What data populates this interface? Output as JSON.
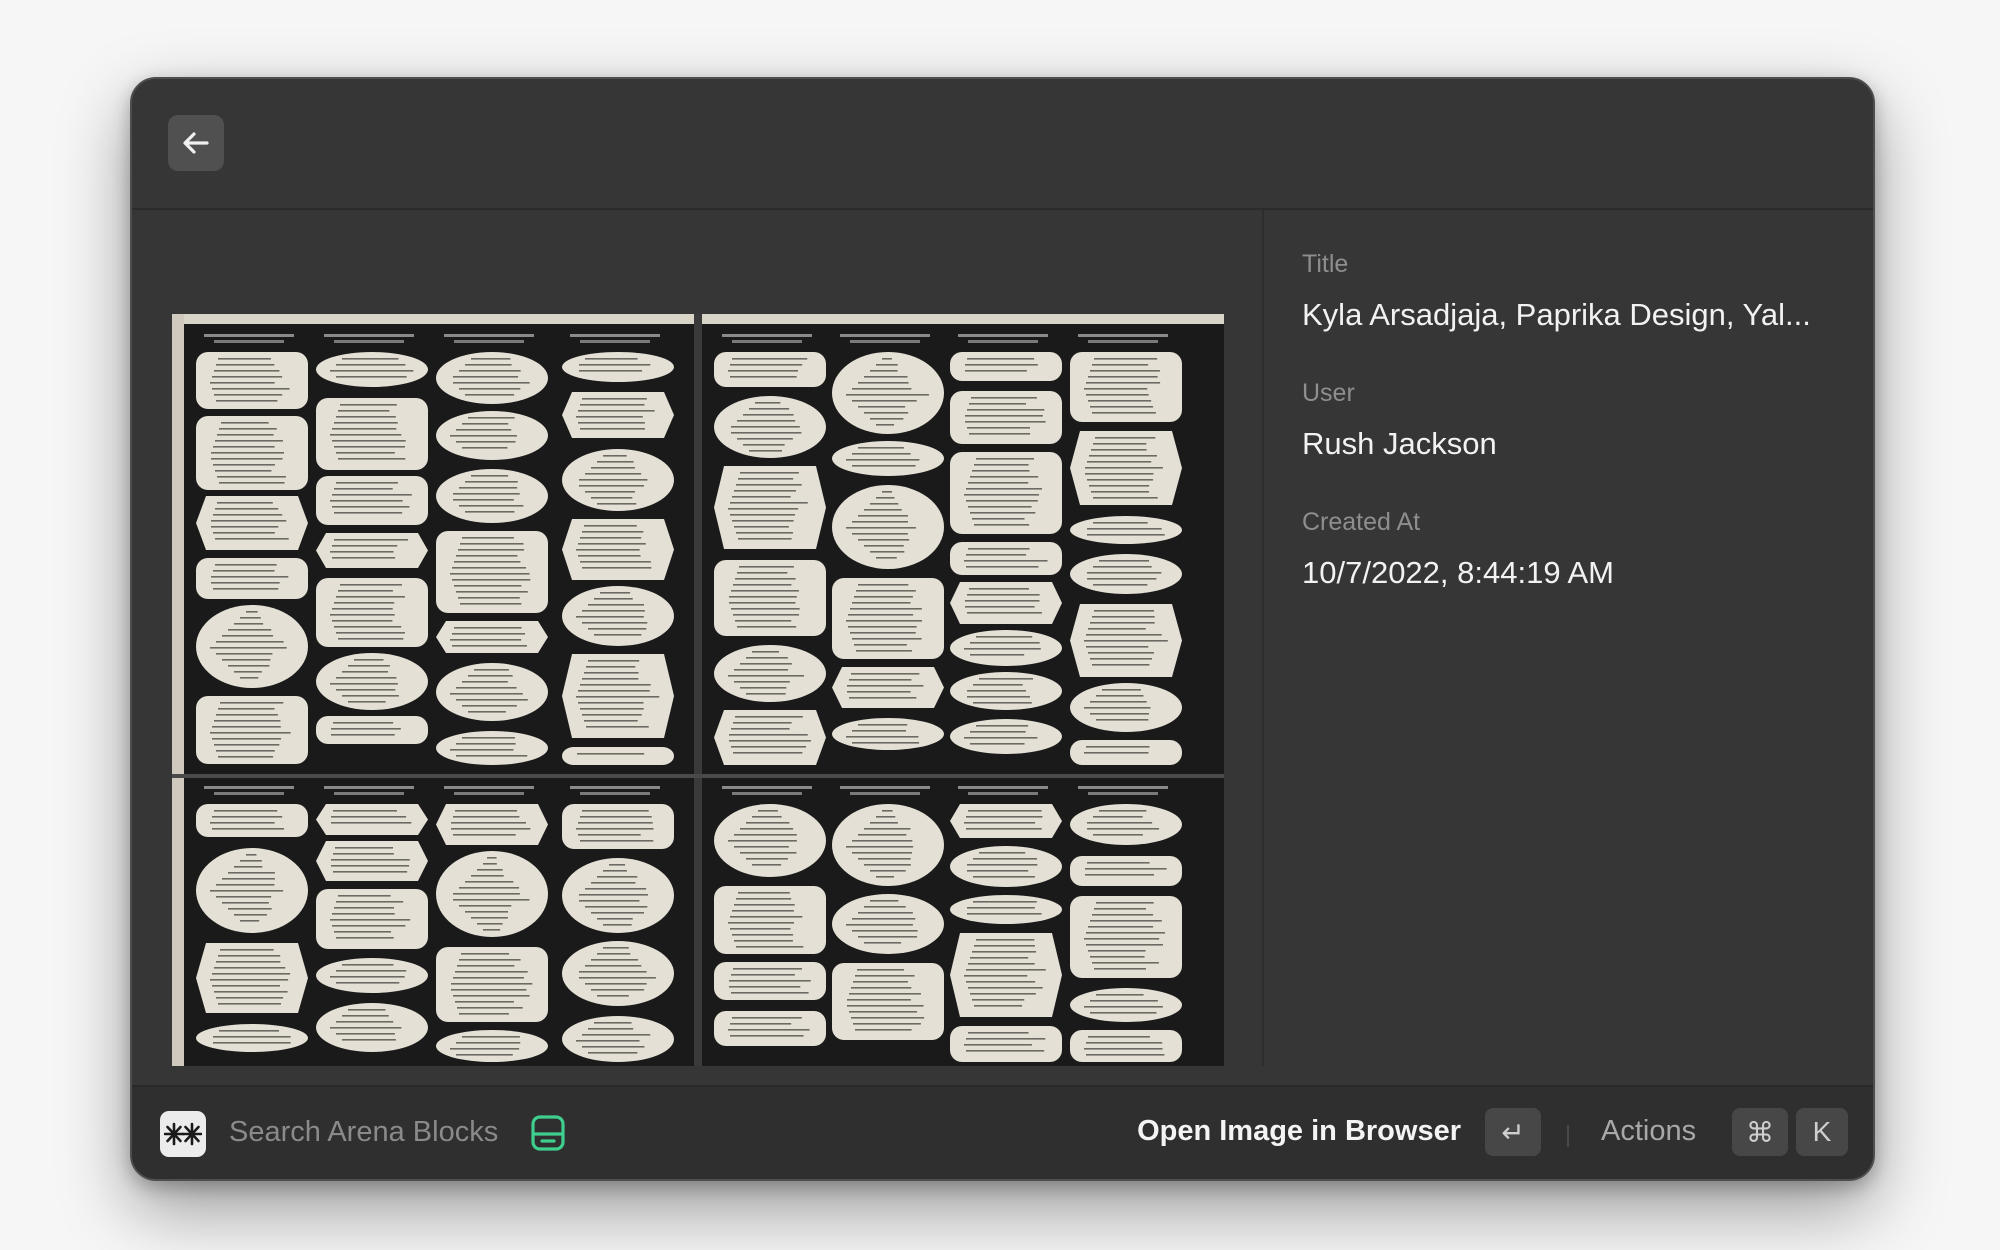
{
  "header": {
    "back_icon": "arrow-left-icon"
  },
  "detail": {
    "title_label": "Title",
    "title_value": "Kyla Arsadjaja, Paprika Design, Yal...",
    "user_label": "User",
    "user_value": "Rush Jackson",
    "created_label": "Created At",
    "created_value": "10/7/2022, 8:44:19 AM"
  },
  "preview": {
    "description_icon": "newspaper-image"
  },
  "footer": {
    "search_placeholder": "Search Arena Blocks",
    "primary_action": "Open Image in Browser",
    "enter_key": "↵",
    "actions_label": "Actions",
    "cmd_key": "⌘",
    "k_key": "K",
    "accent_color": "#3ecf8e"
  }
}
